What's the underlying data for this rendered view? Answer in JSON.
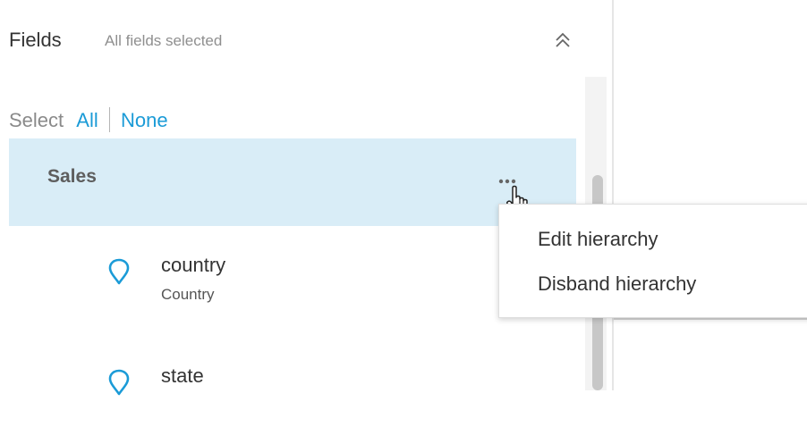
{
  "fields_panel": {
    "title": "Fields",
    "subtitle": "All fields selected",
    "collapse_icon": "double-chevron-up-icon"
  },
  "select_bar": {
    "label": "Select",
    "all_label": "All",
    "none_label": "None"
  },
  "hierarchy_group": {
    "label": "Sales",
    "more_icon": "ellipsis-icon"
  },
  "fields": [
    {
      "name": "country",
      "type": "Country",
      "icon": "map-pin-icon"
    },
    {
      "name": "state",
      "type": "",
      "icon": "map-pin-icon"
    }
  ],
  "context_menu": {
    "items": [
      {
        "label": "Edit hierarchy"
      },
      {
        "label": "Disband hierarchy"
      }
    ]
  },
  "colors": {
    "accent": "#1b9bd7",
    "selected_row": "#d9edf7",
    "muted_text": "#8f8f8f"
  }
}
